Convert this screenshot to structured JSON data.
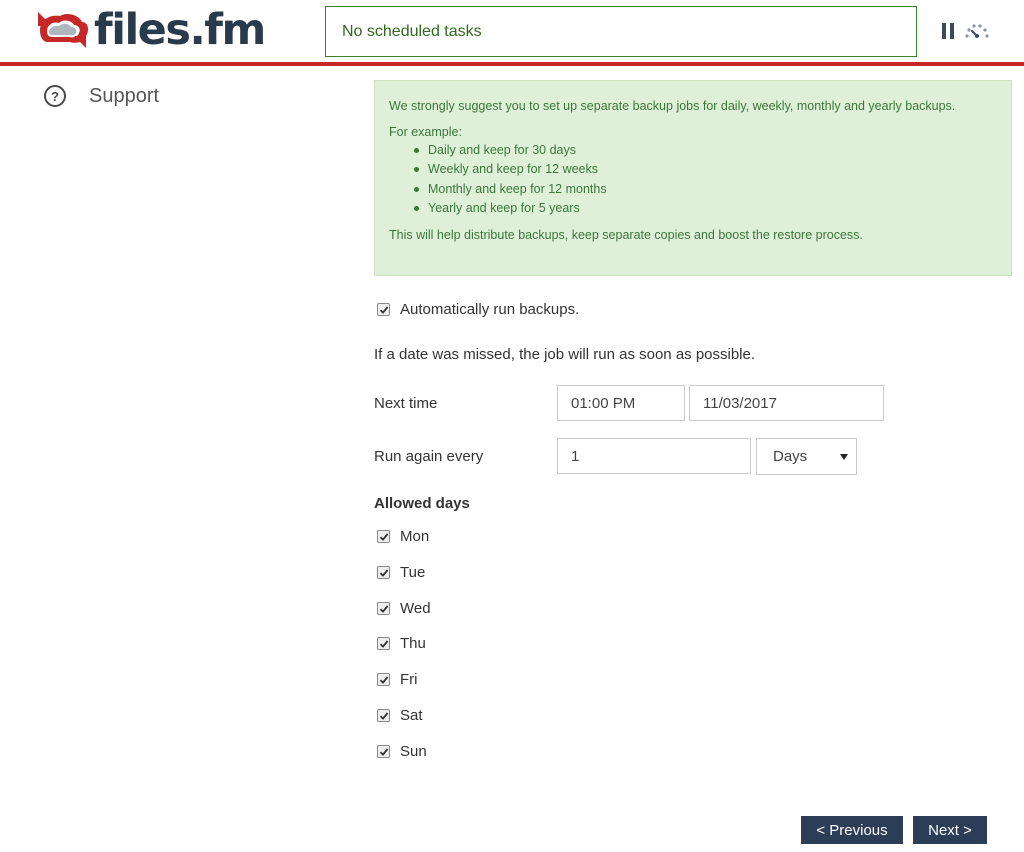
{
  "header": {
    "logo_text": "files.fm",
    "status_text": "No scheduled tasks"
  },
  "sidebar": {
    "support_label": "Support"
  },
  "info": {
    "intro": "We strongly suggest you to set up separate backup jobs for daily, weekly, monthly and yearly backups.",
    "example_heading": "For example:",
    "examples": [
      "Daily and keep for 30 days",
      "Weekly and keep for 12 weeks",
      "Monthly and keep for 12 months",
      "Yearly and keep for 5 years"
    ],
    "footer": "This will help distribute backups, keep separate copies and boost the restore process."
  },
  "form": {
    "auto_run_label": "Automatically run backups.",
    "auto_run_checked": true,
    "missed_note": "If a date was missed, the job will run as soon as possible.",
    "next_time_label": "Next time",
    "next_time_value": "01:00 PM",
    "next_date_value": "11/03/2017",
    "run_again_label": "Run again every",
    "run_again_value": "1",
    "unit_value": "Days",
    "allowed_days_title": "Allowed days",
    "days": [
      {
        "label": "Mon",
        "checked": true
      },
      {
        "label": "Tue",
        "checked": true
      },
      {
        "label": "Wed",
        "checked": true
      },
      {
        "label": "Thu",
        "checked": true
      },
      {
        "label": "Fri",
        "checked": true
      },
      {
        "label": "Sat",
        "checked": true
      },
      {
        "label": "Sun",
        "checked": true
      }
    ]
  },
  "nav": {
    "previous_label": "< Previous",
    "next_label": "Next >"
  },
  "colors": {
    "brand_red": "#c62828",
    "brand_navy": "#2a3a4d",
    "info_bg": "#dff0d8",
    "info_text": "#3c763d",
    "button_bg": "#2c3e57"
  },
  "icons": {
    "logo": "cloud-sync-icon",
    "pause": "pause-icon",
    "speed": "speedometer-icon",
    "help": "help-circle-icon",
    "checkbox": "checkmark-icon",
    "dropdown": "caret-down-icon"
  }
}
